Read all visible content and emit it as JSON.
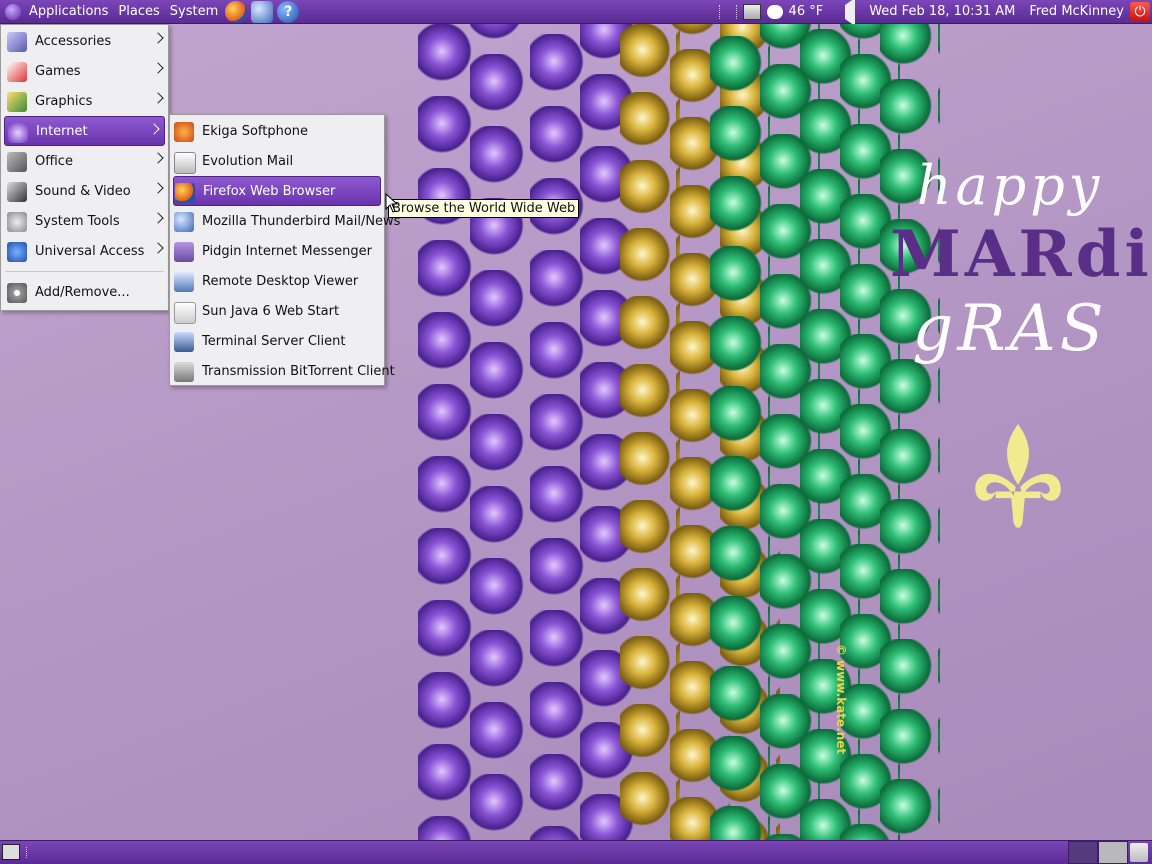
{
  "top_panel": {
    "menus": [
      "Applications",
      "Places",
      "System"
    ],
    "launchers": [
      "firefox-icon",
      "thunderbird-icon",
      "help-icon"
    ],
    "weather": "46 °F",
    "clock": "Wed Feb 18, 10:31 AM",
    "user": "Fred McKinney"
  },
  "main_menu": {
    "items": [
      {
        "label": "Accessories",
        "icon": "accessories-icon"
      },
      {
        "label": "Games",
        "icon": "games-icon"
      },
      {
        "label": "Graphics",
        "icon": "graphics-icon"
      },
      {
        "label": "Internet",
        "icon": "internet-icon"
      },
      {
        "label": "Office",
        "icon": "office-icon"
      },
      {
        "label": "Sound & Video",
        "icon": "sound-video-icon"
      },
      {
        "label": "System Tools",
        "icon": "system-tools-icon"
      },
      {
        "label": "Universal Access",
        "icon": "universal-access-icon"
      }
    ],
    "footer_item": {
      "label": "Add/Remove...",
      "icon": "add-remove-icon"
    }
  },
  "internet_submenu": {
    "items": [
      {
        "label": "Ekiga Softphone",
        "icon": "ekiga-icon"
      },
      {
        "label": "Evolution Mail",
        "icon": "evolution-icon"
      },
      {
        "label": "Firefox Web Browser",
        "icon": "firefox-icon"
      },
      {
        "label": "Mozilla Thunderbird Mail/News",
        "icon": "thunderbird-icon"
      },
      {
        "label": "Pidgin Internet Messenger",
        "icon": "pidgin-icon"
      },
      {
        "label": "Remote Desktop Viewer",
        "icon": "remote-desktop-icon"
      },
      {
        "label": "Sun Java 6 Web Start",
        "icon": "java-icon"
      },
      {
        "label": "Terminal Server Client",
        "icon": "terminal-server-icon"
      },
      {
        "label": "Transmission BitTorrent Client",
        "icon": "transmission-icon"
      }
    ]
  },
  "tooltip": "Browse the World Wide Web",
  "wallpaper": {
    "greeting_line1": "happy",
    "greeting_line2": "MARdi",
    "greeting_line3": "gRAS",
    "copyright": "© www.kate.net"
  },
  "colors": {
    "panel": "#6a36a6",
    "highlight": "#7c45c2",
    "menu_bg": "#efeff2"
  }
}
